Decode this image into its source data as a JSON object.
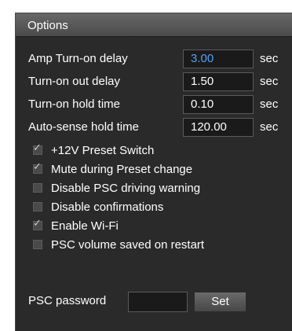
{
  "panel": {
    "title": "Options"
  },
  "fields": [
    {
      "label": "Amp Turn-on delay",
      "value": "3.00",
      "unit": "sec"
    },
    {
      "label": "Turn-on out delay",
      "value": "1.50",
      "unit": "sec"
    },
    {
      "label": "Turn-on hold time",
      "value": "0.10",
      "unit": "sec"
    },
    {
      "label": "Auto-sense hold time",
      "value": "120.00",
      "unit": "sec"
    }
  ],
  "checkboxes": [
    {
      "label": "+12V Preset Switch",
      "checked": true
    },
    {
      "label": "Mute during Preset change",
      "checked": true
    },
    {
      "label": "Disable PSC driving warning",
      "checked": false
    },
    {
      "label": "Disable confirmations",
      "checked": false
    },
    {
      "label": "Enable Wi-Fi",
      "checked": true
    },
    {
      "label": "PSC volume saved on restart",
      "checked": false
    }
  ],
  "password": {
    "label": "PSC password",
    "value": "",
    "button_label": "Set"
  },
  "check_glyph": "✓",
  "colors": {
    "panel_background": "#2a2a2a",
    "header_background": "#5a5a5a",
    "focused_value": "#4da3ff"
  }
}
